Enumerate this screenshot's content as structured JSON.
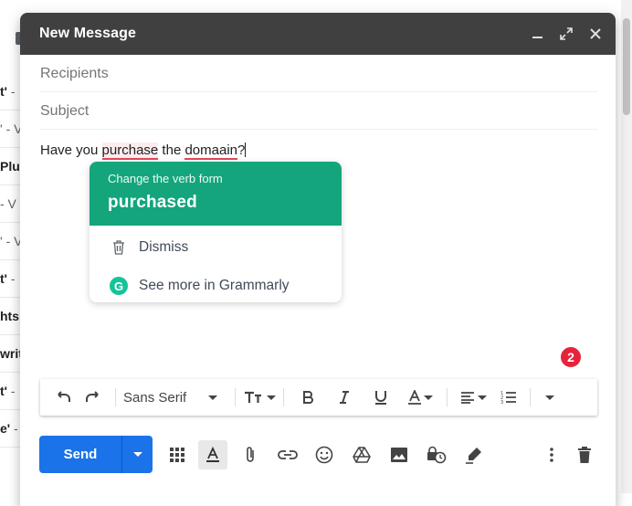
{
  "background_list": [
    {
      "bold": "t'",
      "rest": " -"
    },
    {
      "bold": "",
      "rest": "' - V"
    },
    {
      "bold": "Plu",
      "rest": ""
    },
    {
      "bold": "",
      "rest": "- V"
    },
    {
      "bold": "",
      "rest": "' - V"
    },
    {
      "bold": "t'",
      "rest": " -"
    },
    {
      "bold": "hts",
      "rest": ""
    },
    {
      "bold": "writ",
      "rest": ""
    },
    {
      "bold": "t'",
      "rest": " -"
    },
    {
      "bold": "e'",
      "rest": " -"
    }
  ],
  "compose": {
    "title": "New Message",
    "recipients_placeholder": "Recipients",
    "subject_placeholder": "Subject",
    "body": {
      "before": "Have you ",
      "error1": "purchase",
      "middle": " the ",
      "error2": "domaain",
      "after": "?"
    }
  },
  "grammarly": {
    "suggestion_label": "Change the verb form",
    "suggestion": "purchased",
    "dismiss": "Dismiss",
    "see_more": "See more in Grammarly",
    "badge_count": "2",
    "colors": {
      "accent": "#15a57d",
      "badge": "#e5243b"
    }
  },
  "toolbar": {
    "font": "Sans Serif",
    "icons": [
      "undo-icon",
      "redo-icon",
      "font-size-icon",
      "bold-icon",
      "italic-icon",
      "underline-icon",
      "text-color-icon",
      "align-icon",
      "numbered-list-icon",
      "more-formatting-icon"
    ]
  },
  "bottom": {
    "send_label": "Send",
    "icons": [
      "apps-icon",
      "formatting-toggle-icon",
      "attach-icon",
      "link-icon",
      "emoji-icon",
      "drive-icon",
      "photo-icon",
      "schedule-lock-icon",
      "signature-icon",
      "more-options-icon",
      "delete-icon"
    ],
    "colors": {
      "send": "#1a73e8"
    }
  }
}
